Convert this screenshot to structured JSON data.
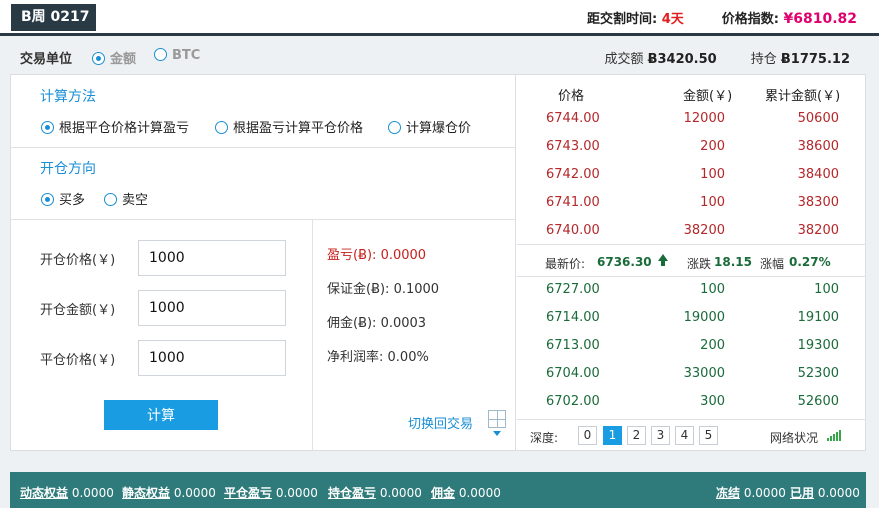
{
  "header": {
    "contract": "B周 0217",
    "delivery_label": "距交割时间:",
    "delivery_value": "4天",
    "index_label": "价格指数:",
    "index_value": "¥6810.82"
  },
  "subbar": {
    "unit_label": "交易单位",
    "unit_options": [
      "金额",
      "BTC"
    ],
    "volume_label": "成交额",
    "volume_value": "Ƀ3420.50",
    "open_interest_label": "持仓",
    "open_interest_value": "Ƀ1775.12"
  },
  "calculator": {
    "method_title": "计算方法",
    "methods": [
      "根据平仓价格计算盈亏",
      "根据盈亏计算平仓价格",
      "计算爆仓价"
    ],
    "direction_title": "开仓方向",
    "directions": [
      "买多",
      "卖空"
    ],
    "fields": [
      {
        "label": "开仓价格(￥)",
        "value": "1000"
      },
      {
        "label": "开仓金额(￥)",
        "value": "1000"
      },
      {
        "label": "平仓价格(￥)",
        "value": "1000"
      }
    ],
    "calc_button": "计算",
    "results": {
      "pnl_label": "盈亏(Ƀ):",
      "pnl_value": "0.0000",
      "margin_label": "保证金(Ƀ):",
      "margin_value": "0.1000",
      "fee_label": "佣金(Ƀ):",
      "fee_value": "0.0003",
      "roi_label": "净利润率:",
      "roi_value": "0.00%"
    },
    "switch_label": "切换回交易"
  },
  "orderbook": {
    "headers": [
      "价格",
      "金额(￥)",
      "累计金额(￥)"
    ],
    "asks": [
      {
        "price": "6744.00",
        "amount": "12000",
        "cum": "50600"
      },
      {
        "price": "6743.00",
        "amount": "200",
        "cum": "38600"
      },
      {
        "price": "6742.00",
        "amount": "100",
        "cum": "38400"
      },
      {
        "price": "6741.00",
        "amount": "100",
        "cum": "38300"
      },
      {
        "price": "6740.00",
        "amount": "38200",
        "cum": "38200"
      }
    ],
    "last": {
      "last_label": "最新价:",
      "last_value": "6736.30",
      "change_label": "涨跌",
      "change_value": "18.15",
      "pct_label": "涨幅",
      "pct_value": "0.27%"
    },
    "bids": [
      {
        "price": "6727.00",
        "amount": "100",
        "cum": "100"
      },
      {
        "price": "6714.00",
        "amount": "19000",
        "cum": "19100"
      },
      {
        "price": "6713.00",
        "amount": "200",
        "cum": "19300"
      },
      {
        "price": "6704.00",
        "amount": "33000",
        "cum": "52300"
      },
      {
        "price": "6702.00",
        "amount": "300",
        "cum": "52600"
      }
    ],
    "depth_label": "深度:",
    "depth_options": [
      "0",
      "1",
      "2",
      "3",
      "4",
      "5"
    ],
    "depth_selected": "1",
    "network_label": "网络状况"
  },
  "footer": {
    "dynamic_label": "动态权益",
    "dynamic_value": "0.0000",
    "static_label": "静态权益",
    "static_value": "0.0000",
    "close_label": "平仓盈亏",
    "close_value": "0.0000",
    "hold_label": "持仓盈亏",
    "hold_value": "0.0000",
    "fee_label": "佣金",
    "fee_value": "0.0000",
    "frozen_label": "冻结",
    "frozen_value": "0.0000",
    "used_label": "已用",
    "used_value": "0.0000"
  }
}
